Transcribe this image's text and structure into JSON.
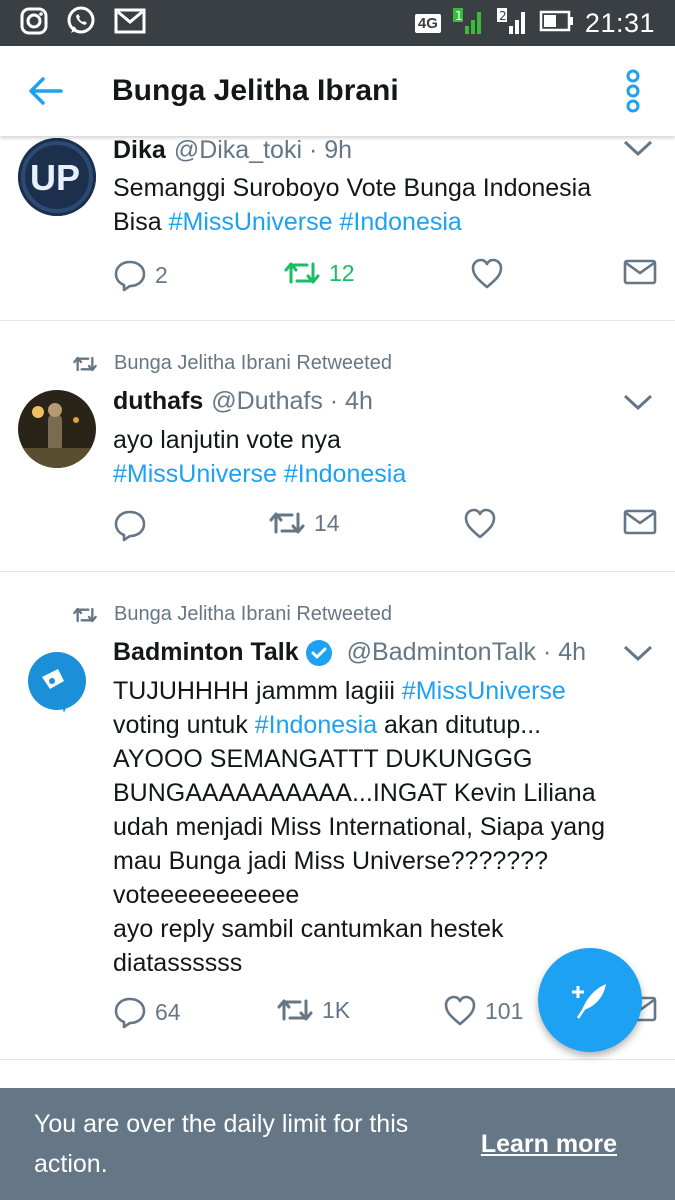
{
  "status_bar": {
    "time": "21:31",
    "network": "4G",
    "icons": [
      "instagram-icon",
      "whatsapp-icon",
      "gmail-icon",
      "signal-icon",
      "battery-icon"
    ]
  },
  "header": {
    "title": "Bunga Jelitha Ibrani"
  },
  "tweets": [
    {
      "name": "Dika",
      "handle": "@Dika_toki · 9h",
      "text_plain": "Semanggi Suroboyo Vote Bunga Indonesia Bisa",
      "hashtags": [
        "#MissUniverse",
        "#Indonesia"
      ],
      "replies": "2",
      "retweets": "12",
      "likes": "",
      "retweeted_by_me": true
    },
    {
      "retweet_label": "Bunga Jelitha Ibrani Retweeted",
      "name": "duthafs",
      "handle": "@Duthafs · 4h",
      "text_plain": "ayo lanjutin vote nya",
      "hashtags": [
        "#MissUniverse",
        "#Indonesia"
      ],
      "replies": "",
      "retweets": "14",
      "likes": ""
    },
    {
      "retweet_label": "Bunga Jelitha Ibrani Retweeted",
      "name": "Badminton Talk",
      "verified": true,
      "handle": "@BadmintonTalk · 4h",
      "text_parts": [
        "TUJUHHHH jammm lagiii ",
        "#MissUniverse",
        "voting untuk ",
        "#Indonesia",
        " akan ditutup...",
        "AYOOO SEMANGATTT DUKUNGGG",
        "BUNGAAAAAAAAAA...INGAT Kevin Liliana",
        "udah menjadi Miss International, Siapa yang",
        "mau Bunga jadi Miss Universe???????",
        "voteeeeeeeeeee",
        "ayo reply sambil cantumkan hestek",
        "diatassssss"
      ],
      "replies": "64",
      "retweets": "1K",
      "likes": "101"
    }
  ],
  "snackbar": {
    "message": "You are over the daily limit for this action.",
    "action": "Learn more"
  },
  "colors": {
    "accent": "#1da1f2",
    "retweet_active": "#17bf63",
    "muted": "#657786",
    "snackbar_bg": "#657786",
    "status_bar_bg": "#3a3f44"
  }
}
